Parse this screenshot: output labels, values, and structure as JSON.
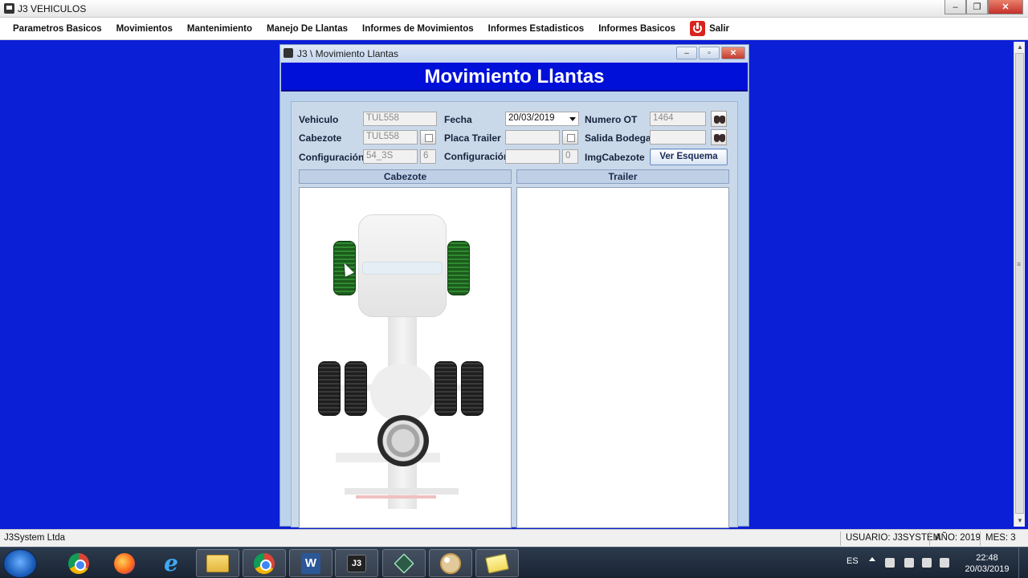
{
  "window": {
    "title": "J3 VEHICULOS",
    "controls": {
      "minimize": "–",
      "maximize": "❐",
      "close": "✕"
    }
  },
  "menu": {
    "items": [
      "Parametros Basicos",
      "Movimientos",
      "Mantenimiento",
      "Manejo De Llantas",
      "Informes de Movimientos",
      "Informes Estadisticos",
      "Informes Basicos"
    ],
    "exit_label": "Salir",
    "exit_color": "#d9231e"
  },
  "child_window": {
    "title": "J3 \\ Movimiento Llantas",
    "controls": {
      "minimize": "–",
      "maximize": "▫",
      "close": "✕"
    },
    "header": "Movimiento Llantas",
    "header_color": "#0010d8"
  },
  "form": {
    "vehiculo": {
      "label": "Vehiculo",
      "value": "TUL558"
    },
    "cabezote": {
      "label": "Cabezote",
      "value": "TUL558"
    },
    "configuracion_cab": {
      "label": "Configuración",
      "value": "54_3S",
      "count": "6"
    },
    "fecha": {
      "label": "Fecha",
      "value": "20/03/2019"
    },
    "placa_trailer": {
      "label": "Placa Trailer",
      "value": ""
    },
    "configuracion_trailer": {
      "label": "Configuración",
      "value": "",
      "count": "0"
    },
    "numero_ot": {
      "label": "Numero OT",
      "value": "1464"
    },
    "salida_bodega": {
      "label": "Salida Bodega",
      "value": ""
    },
    "img_cabezote": {
      "label": "ImgCabezote",
      "button": "Ver Esquema"
    }
  },
  "sections": {
    "cabezote": "Cabezote",
    "trailer": "Trailer"
  },
  "tires": {
    "front_selected_color": "#2f8a2f",
    "rear_color": "#1f1f1f",
    "count_front": 2,
    "count_rear": 4,
    "spare": 1
  },
  "statusbar": {
    "company": "J3System Ltda",
    "usuario": "USUARIO: J3SYSTEM",
    "anio": "AÑO: 2019",
    "mes": "MES: 3"
  },
  "taskbar": {
    "apps": [
      "chrome-icon",
      "firefox-icon",
      "ie-icon",
      "folder-icon",
      "chrome-icon",
      "word-icon",
      "j3-icon",
      "tool-icon",
      "paint-icon",
      "sticky-notes-icon"
    ],
    "ie_glyph": "e",
    "word_glyph": "W",
    "j3_glyph": "J3",
    "lang": "ES",
    "time": "22:48",
    "date": "20/03/2019"
  }
}
